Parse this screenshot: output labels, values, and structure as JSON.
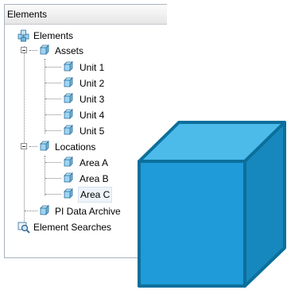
{
  "panel": {
    "title": "Elements"
  },
  "tree": {
    "root": {
      "label": "Elements",
      "icon": "elements-root-icon"
    },
    "assets": {
      "label": "Assets",
      "expander": "collapse",
      "children": [
        {
          "label": "Unit 1"
        },
        {
          "label": "Unit 2"
        },
        {
          "label": "Unit 3"
        },
        {
          "label": "Unit 4"
        },
        {
          "label": "Unit 5"
        }
      ]
    },
    "locations": {
      "label": "Locations",
      "expander": "collapse",
      "children": [
        {
          "label": "Area A"
        },
        {
          "label": "Area B"
        },
        {
          "label": "Area C",
          "selected": true
        }
      ]
    },
    "pi_archive": {
      "label": "PI Data Archive"
    },
    "element_searches": {
      "label": "Element Searches",
      "icon": "search-icon"
    }
  },
  "colors": {
    "element_icon": "#5aa9e6",
    "cube_front": "#1e9bd8",
    "cube_top": "#4cbbe9",
    "cube_side": "#1788bd",
    "cube_edge": "#0c6f9b"
  }
}
